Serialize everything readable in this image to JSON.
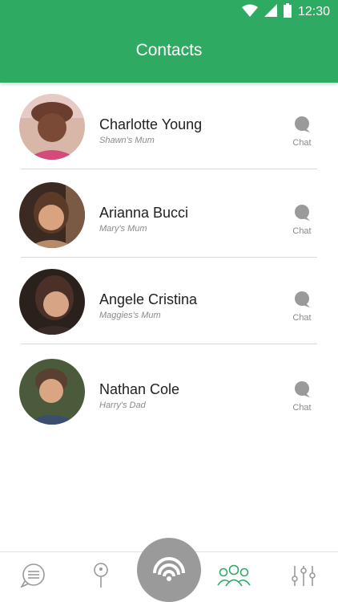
{
  "status_bar": {
    "time": "12:30"
  },
  "header": {
    "title": "Contacts"
  },
  "contacts": [
    {
      "name": "Charlotte Young",
      "relation": "Shawn's Mum",
      "chat_label": "Chat"
    },
    {
      "name": "Arianna Bucci",
      "relation": "Mary's Mum",
      "chat_label": "Chat"
    },
    {
      "name": "Angele Cristina",
      "relation": "Maggies's Mum",
      "chat_label": "Chat"
    },
    {
      "name": "Nathan Cole",
      "relation": "Harry's Dad",
      "chat_label": "Chat"
    }
  ],
  "bottom_nav": {
    "items": [
      {
        "icon": "chat-list-icon"
      },
      {
        "icon": "location-pin-icon"
      },
      {
        "icon": "signal-icon"
      },
      {
        "icon": "contacts-icon"
      },
      {
        "icon": "settings-sliders-icon"
      }
    ]
  },
  "colors": {
    "accent": "#2eaa62",
    "fab": "#9a9a9a",
    "icon_gray": "#9a9a9a"
  }
}
